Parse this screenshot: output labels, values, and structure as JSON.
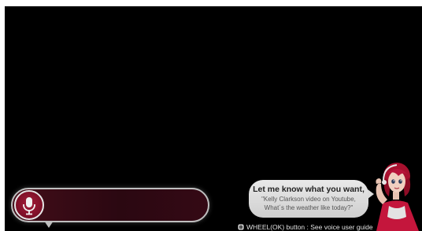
{
  "voice_input": {
    "icon": "microphone-icon",
    "value": ""
  },
  "assistant_bubble": {
    "title": "Let me know what you want,",
    "example_1": "\"Kelly Clarkson video on Youtube,",
    "example_2": "What´s the weather like today?\""
  },
  "footer_hint": {
    "icon": "wheel-icon",
    "text": "WHEEL(OK) button : See voice user guide"
  },
  "colors": {
    "screen_bg": "#000000",
    "accent": "#8a1230",
    "bubble_bg": "#dcdcdc"
  }
}
